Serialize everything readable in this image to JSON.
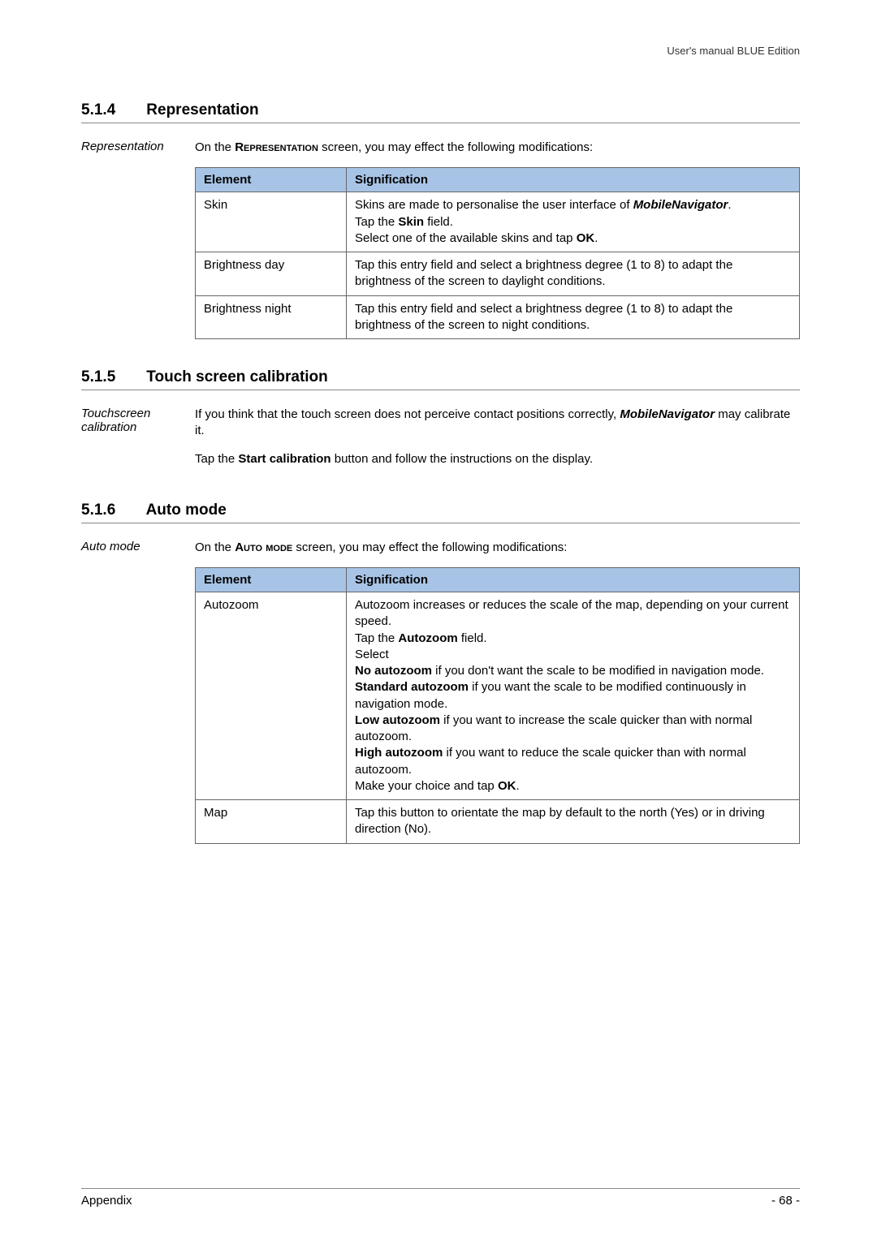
{
  "header": {
    "running": "User's manual BLUE Edition"
  },
  "sections": [
    {
      "number": "5.1.4",
      "title": "Representation",
      "margin": "Representation",
      "intro_pre": "On the ",
      "intro_sc": "Representation",
      "intro_post": " screen, you may effect the following modifications:",
      "table": {
        "h1": "Element",
        "h2": "Signification",
        "rows": [
          {
            "element": "Skin",
            "sig_parts": {
              "p1": "Skins are made to personalise the user interface of ",
              "bi1": "MobileNavigator",
              "p2": ".",
              "p3": "Tap the ",
              "b1": "Skin",
              "p4": " field.",
              "p5": "Select one of the available skins and tap ",
              "b2": "OK",
              "p6": "."
            }
          },
          {
            "element": "Brightness day",
            "sig": "Tap this entry field and select a brightness degree (1 to 8) to adapt the brightness of the screen to daylight conditions."
          },
          {
            "element": "Brightness night",
            "sig": "Tap this entry field and select a brightness degree (1 to 8) to adapt the brightness of the screen to night conditions."
          }
        ]
      }
    },
    {
      "number": "5.1.5",
      "title": "Touch screen calibration",
      "margin": "Touchscreen calibration",
      "para1": {
        "p1": "If you think that the touch screen does not perceive contact positions correctly, ",
        "bi1": "MobileNavigator",
        "p2": " may calibrate it."
      },
      "para2": {
        "p1": "Tap the ",
        "b1": "Start calibration",
        "p2": " button and follow the instructions on the display."
      }
    },
    {
      "number": "5.1.6",
      "title": "Auto mode",
      "margin": "Auto mode",
      "intro_pre": "On the ",
      "intro_sc": "Auto mode",
      "intro_post": " screen, you may effect the following modifications:",
      "table": {
        "h1": "Element",
        "h2": "Signification",
        "rows": [
          {
            "element": "Autozoom",
            "sig_parts": {
              "l1": "Autozoom increases or reduces the scale of the map, depending on your current speed.",
              "l2a": "Tap the ",
              "l2b": "Autozoom",
              "l2c": " field.",
              "l3": "Select",
              "l4a": "No autozoom",
              "l4b": " if you don't want the scale to be modified in navigation mode.",
              "l5a": "Standard autozoom",
              "l5b": " if you want the scale to be modified continuously in navigation mode.",
              "l6a": "Low autozoom",
              "l6b": " if you want to increase the scale quicker than with normal autozoom.",
              "l7a": "High autozoom",
              "l7b": " if you want to reduce the scale quicker than with normal autozoom.",
              "l8a": "Make your choice and tap ",
              "l8b": "OK",
              "l8c": "."
            }
          },
          {
            "element": "Map",
            "sig": "Tap this button to orientate the map by default to the north (Yes) or in driving direction (No)."
          }
        ]
      }
    }
  ],
  "footer": {
    "left": "Appendix",
    "right": "- 68 -"
  },
  "chart_data": {
    "type": "table",
    "tables": [
      {
        "title": "Representation settings",
        "columns": [
          "Element",
          "Signification"
        ],
        "rows": [
          [
            "Skin",
            "Skins are made to personalise the user interface of MobileNavigator. Tap the Skin field. Select one of the available skins and tap OK."
          ],
          [
            "Brightness day",
            "Tap this entry field and select a brightness degree (1 to 8) to adapt the brightness of the screen to daylight conditions."
          ],
          [
            "Brightness night",
            "Tap this entry field and select a brightness degree (1 to 8) to adapt the brightness of the screen to night conditions."
          ]
        ]
      },
      {
        "title": "Auto mode settings",
        "columns": [
          "Element",
          "Signification"
        ],
        "rows": [
          [
            "Autozoom",
            "Autozoom increases or reduces the scale of the map, depending on your current speed. Tap the Autozoom field. Select No autozoom if you don't want the scale to be modified in navigation mode. Standard autozoom if you want the scale to be modified continuously in navigation mode. Low autozoom if you want to increase the scale quicker than with normal autozoom. High autozoom if you want to reduce the scale quicker than with normal autozoom. Make your choice and tap OK."
          ],
          [
            "Map",
            "Tap this button to orientate the map by default to the north (Yes) or in driving direction (No)."
          ]
        ]
      }
    ]
  }
}
